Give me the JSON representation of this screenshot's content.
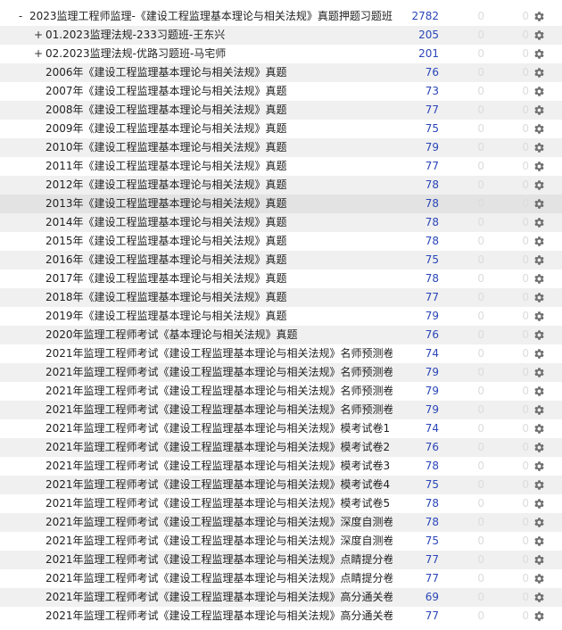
{
  "colors": {
    "new_count": "#2a46b8",
    "zero_count": "#dcdcdc",
    "alt_row": "#f0f0f0",
    "selected_row": "#e3e3e3",
    "gear": "#6e6e6e"
  },
  "icons": {
    "options": "gear-icon"
  },
  "decks": [
    {
      "expander": "-",
      "level": 0,
      "name": "2023监理工程师监理-《建设工程监理基本理论与相关法规》真题押题习题班",
      "new": "2782",
      "learn": "0",
      "due": "0"
    },
    {
      "expander": "+",
      "level": 1,
      "name": "01.2023监理法规-233习题班-王东兴",
      "new": "205",
      "learn": "0",
      "due": "0"
    },
    {
      "expander": "+",
      "level": 1,
      "name": "02.2023监理法规-优路习题班-马宅师",
      "new": "201",
      "learn": "0",
      "due": "0"
    },
    {
      "expander": "",
      "level": 1,
      "name": "2006年《建设工程监理基本理论与相关法规》真题",
      "new": "76",
      "learn": "0",
      "due": "0"
    },
    {
      "expander": "",
      "level": 1,
      "name": "2007年《建设工程监理基本理论与相关法规》真题",
      "new": "73",
      "learn": "0",
      "due": "0"
    },
    {
      "expander": "",
      "level": 1,
      "name": "2008年《建设工程监理基本理论与相关法规》真题",
      "new": "77",
      "learn": "0",
      "due": "0"
    },
    {
      "expander": "",
      "level": 1,
      "name": "2009年《建设工程监理基本理论与相关法规》真题",
      "new": "75",
      "learn": "0",
      "due": "0"
    },
    {
      "expander": "",
      "level": 1,
      "name": "2010年《建设工程监理基本理论与相关法规》真题",
      "new": "79",
      "learn": "0",
      "due": "0"
    },
    {
      "expander": "",
      "level": 1,
      "name": "2011年《建设工程监理基本理论与相关法规》真题",
      "new": "77",
      "learn": "0",
      "due": "0"
    },
    {
      "expander": "",
      "level": 1,
      "name": "2012年《建设工程监理基本理论与相关法规》真题",
      "new": "78",
      "learn": "0",
      "due": "0"
    },
    {
      "expander": "",
      "level": 1,
      "name": "2013年《建设工程监理基本理论与相关法规》真题",
      "new": "78",
      "learn": "0",
      "due": "0",
      "selected": true
    },
    {
      "expander": "",
      "level": 1,
      "name": "2014年《建设工程监理基本理论与相关法规》真题",
      "new": "78",
      "learn": "0",
      "due": "0"
    },
    {
      "expander": "",
      "level": 1,
      "name": "2015年《建设工程监理基本理论与相关法规》真题",
      "new": "78",
      "learn": "0",
      "due": "0"
    },
    {
      "expander": "",
      "level": 1,
      "name": "2016年《建设工程监理基本理论与相关法规》真题",
      "new": "75",
      "learn": "0",
      "due": "0"
    },
    {
      "expander": "",
      "level": 1,
      "name": "2017年《建设工程监理基本理论与相关法规》真题",
      "new": "78",
      "learn": "0",
      "due": "0"
    },
    {
      "expander": "",
      "level": 1,
      "name": "2018年《建设工程监理基本理论与相关法规》真题",
      "new": "77",
      "learn": "0",
      "due": "0"
    },
    {
      "expander": "",
      "level": 1,
      "name": "2019年《建设工程监理基本理论与相关法规》真题",
      "new": "79",
      "learn": "0",
      "due": "0"
    },
    {
      "expander": "",
      "level": 1,
      "name": "2020年监理工程师考试《基本理论与相关法规》真题",
      "new": "76",
      "learn": "0",
      "due": "0"
    },
    {
      "expander": "",
      "level": 1,
      "name": "2021年监理工程师考试《建设工程监理基本理论与相关法规》名师预测卷1",
      "new": "74",
      "learn": "0",
      "due": "0"
    },
    {
      "expander": "",
      "level": 1,
      "name": "2021年监理工程师考试《建设工程监理基本理论与相关法规》名师预测卷2",
      "new": "79",
      "learn": "0",
      "due": "0"
    },
    {
      "expander": "",
      "level": 1,
      "name": "2021年监理工程师考试《建设工程监理基本理论与相关法规》名师预测卷3",
      "new": "79",
      "learn": "0",
      "due": "0"
    },
    {
      "expander": "",
      "level": 1,
      "name": "2021年监理工程师考试《建设工程监理基本理论与相关法规》名师预测卷4",
      "new": "79",
      "learn": "0",
      "due": "0"
    },
    {
      "expander": "",
      "level": 1,
      "name": "2021年监理工程师考试《建设工程监理基本理论与相关法规》模考试卷1",
      "new": "74",
      "learn": "0",
      "due": "0"
    },
    {
      "expander": "",
      "level": 1,
      "name": "2021年监理工程师考试《建设工程监理基本理论与相关法规》模考试卷2",
      "new": "76",
      "learn": "0",
      "due": "0"
    },
    {
      "expander": "",
      "level": 1,
      "name": "2021年监理工程师考试《建设工程监理基本理论与相关法规》模考试卷3",
      "new": "78",
      "learn": "0",
      "due": "0"
    },
    {
      "expander": "",
      "level": 1,
      "name": "2021年监理工程师考试《建设工程监理基本理论与相关法规》模考试卷4",
      "new": "75",
      "learn": "0",
      "due": "0"
    },
    {
      "expander": "",
      "level": 1,
      "name": "2021年监理工程师考试《建设工程监理基本理论与相关法规》模考试卷5",
      "new": "78",
      "learn": "0",
      "due": "0"
    },
    {
      "expander": "",
      "level": 1,
      "name": "2021年监理工程师考试《建设工程监理基本理论与相关法规》深度自测卷1",
      "new": "78",
      "learn": "0",
      "due": "0"
    },
    {
      "expander": "",
      "level": 1,
      "name": "2021年监理工程师考试《建设工程监理基本理论与相关法规》深度自测卷2",
      "new": "75",
      "learn": "0",
      "due": "0"
    },
    {
      "expander": "",
      "level": 1,
      "name": "2021年监理工程师考试《建设工程监理基本理论与相关法规》点睛提分卷1",
      "new": "77",
      "learn": "0",
      "due": "0"
    },
    {
      "expander": "",
      "level": 1,
      "name": "2021年监理工程师考试《建设工程监理基本理论与相关法规》点睛提分卷2",
      "new": "77",
      "learn": "0",
      "due": "0"
    },
    {
      "expander": "",
      "level": 1,
      "name": "2021年监理工程师考试《建设工程监理基本理论与相关法规》高分通关卷1",
      "new": "69",
      "learn": "0",
      "due": "0"
    },
    {
      "expander": "",
      "level": 1,
      "name": "2021年监理工程师考试《建设工程监理基本理论与相关法规》高分通关卷2",
      "new": "77",
      "learn": "0",
      "due": "0"
    }
  ]
}
